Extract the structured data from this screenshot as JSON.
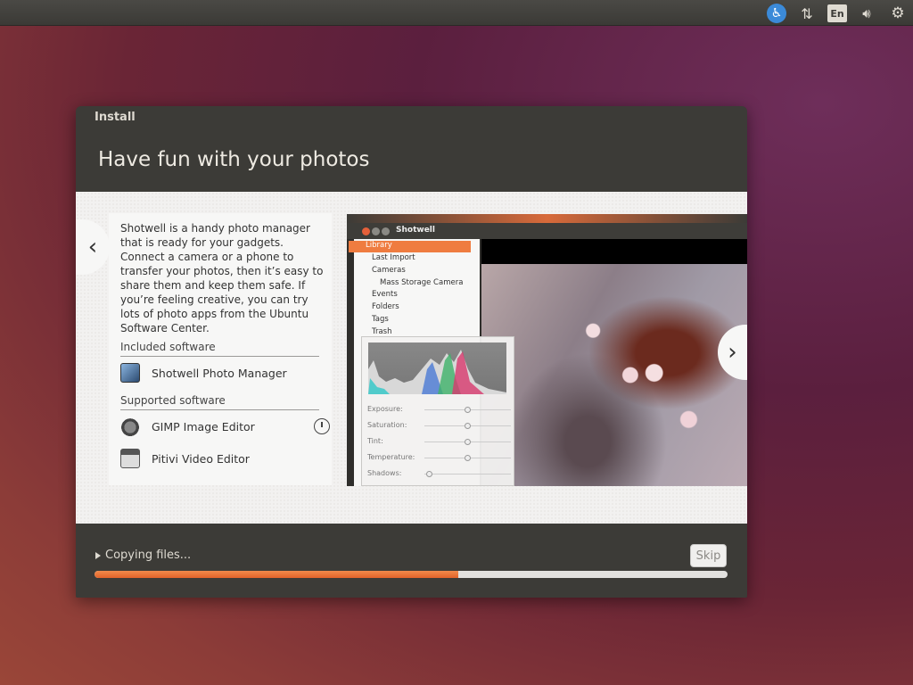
{
  "top_panel": {
    "language_indicator": "En",
    "icons": [
      "accessibility-icon",
      "network-icon",
      "keyboard-language-icon",
      "volume-icon",
      "gear-icon"
    ]
  },
  "dialog": {
    "title": "Install",
    "header": "Have fun with your photos",
    "description": "Shotwell is a handy photo manager that is ready for your gadgets. Connect a camera or a phone to transfer your photos, then it’s easy to share them and keep them safe. If you’re feeling creative, you can try lots of photo apps from the Ubuntu Software Center.",
    "included_title": "Included software",
    "included": [
      {
        "label": "Shotwell Photo Manager",
        "icon": "shotwell-icon"
      }
    ],
    "supported_title": "Supported software",
    "supported": [
      {
        "label": "GIMP Image Editor",
        "icon": "gimp-icon"
      },
      {
        "label": "Pitivi Video Editor",
        "icon": "pitivi-icon"
      }
    ],
    "nav": {
      "prev": "‹",
      "next": "›"
    },
    "progress": {
      "label": "Copying files...",
      "fraction": 0.575,
      "skip_label": "Skip"
    }
  },
  "shotwell_window": {
    "title": "Shotwell",
    "sidebar": [
      {
        "label": "Library",
        "selected": true
      },
      {
        "label": "Last Import"
      },
      {
        "label": "Cameras"
      },
      {
        "label": "Mass Storage Camera"
      },
      {
        "label": "Events"
      },
      {
        "label": "Folders"
      },
      {
        "label": "Tags"
      },
      {
        "label": "Trash"
      }
    ],
    "adjustments": [
      {
        "label": "Exposure:",
        "level": 0.5
      },
      {
        "label": "Saturation:",
        "level": 0.5
      },
      {
        "label": "Tint:",
        "level": 0.5
      },
      {
        "label": "Temperature:",
        "level": 0.5
      },
      {
        "label": "Shadows:",
        "level": 0.05
      }
    ]
  },
  "colors": {
    "accent": "#e2632a",
    "panel": "#3c3b37"
  }
}
